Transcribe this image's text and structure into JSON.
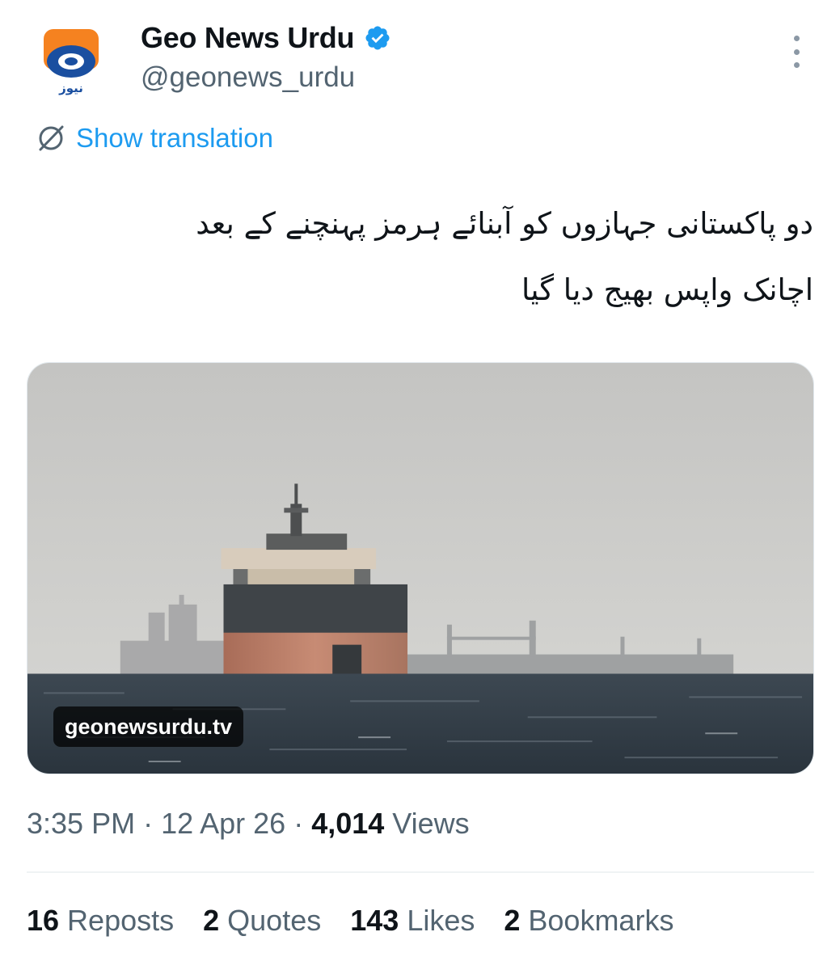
{
  "account": {
    "display_name": "Geo News Urdu",
    "handle": "@geonews_urdu",
    "avatar_text": "نیوز",
    "verified_icon": "verified-badge-icon",
    "brand_colors": {
      "orange": "#f58220",
      "blue": "#1a4fa0",
      "verified": "#1d9bf0"
    }
  },
  "translate": {
    "label": "Show translation",
    "icon": "globe-slash-icon"
  },
  "tweet": {
    "line1": "دو پاکستانی جہازوں کو آبنائے ہرمز پہنچنے کے بعد",
    "line2": "اچانک واپس بھیج دیا گیا"
  },
  "media": {
    "watermark": "geonewsurdu.tv"
  },
  "meta": {
    "time": "3:35 PM",
    "sep1": " · ",
    "date": "12 Apr 26",
    "sep2": " · ",
    "views_count": "4,014",
    "views_label": " Views"
  },
  "stats": [
    {
      "count": "16",
      "label": "Reposts"
    },
    {
      "count": "2",
      "label": "Quotes"
    },
    {
      "count": "143",
      "label": "Likes"
    },
    {
      "count": "2",
      "label": "Bookmarks"
    }
  ]
}
